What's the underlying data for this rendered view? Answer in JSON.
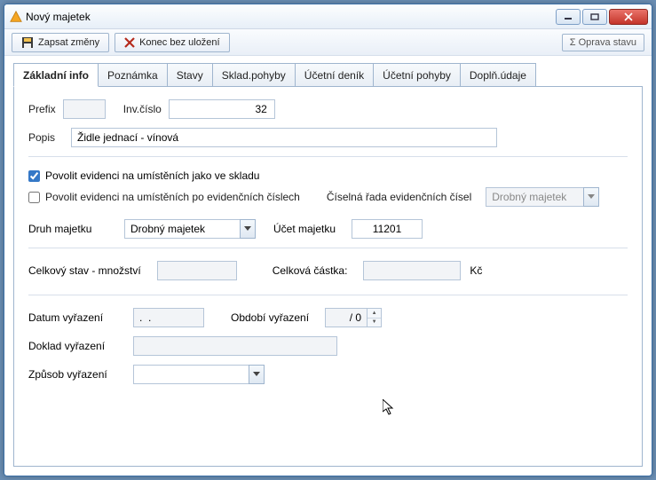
{
  "window": {
    "title": "Nový majetek"
  },
  "toolbar": {
    "save": "Zapsat změny",
    "cancel": "Konec bez uložení",
    "status": "Σ Oprava stavu"
  },
  "tabs": [
    "Základní info",
    "Poznámka",
    "Stavy",
    "Sklad.pohyby",
    "Účetní deník",
    "Účetní pohyby",
    "Doplň.údaje"
  ],
  "form": {
    "prefix_label": "Prefix",
    "prefix_value": "",
    "inv_label": "Inv.číslo",
    "inv_value": "32",
    "popis_label": "Popis",
    "popis_value": "Židle jednací - vínová",
    "chk_location": "Povolit evidenci na umístěních jako ve skladu",
    "chk_location_checked": true,
    "chk_evnum": "Povolit evidenci na umístěních po evidenčních číslech",
    "chk_evnum_checked": false,
    "evnum_label": "Číselná řada evidenčních čísel",
    "evnum_value": "Drobný majetek",
    "druh_label": "Druh majetku",
    "druh_value": "Drobný majetek",
    "ucet_label": "Účet majetku",
    "ucet_value": "11201",
    "mnozstvi_label": "Celkový stav - množství",
    "mnozstvi_value": "",
    "castka_label": "Celková částka:",
    "castka_value": "",
    "castka_unit": "Kč",
    "datum_vyr_label": "Datum vyřazení",
    "datum_vyr_value": ".  .",
    "obdobi_label": "Období vyřazení",
    "obdobi_value": "/ 0",
    "doklad_label": "Doklad vyřazení",
    "doklad_value": "",
    "zpusob_label": "Způsob vyřazení",
    "zpusob_value": ""
  }
}
